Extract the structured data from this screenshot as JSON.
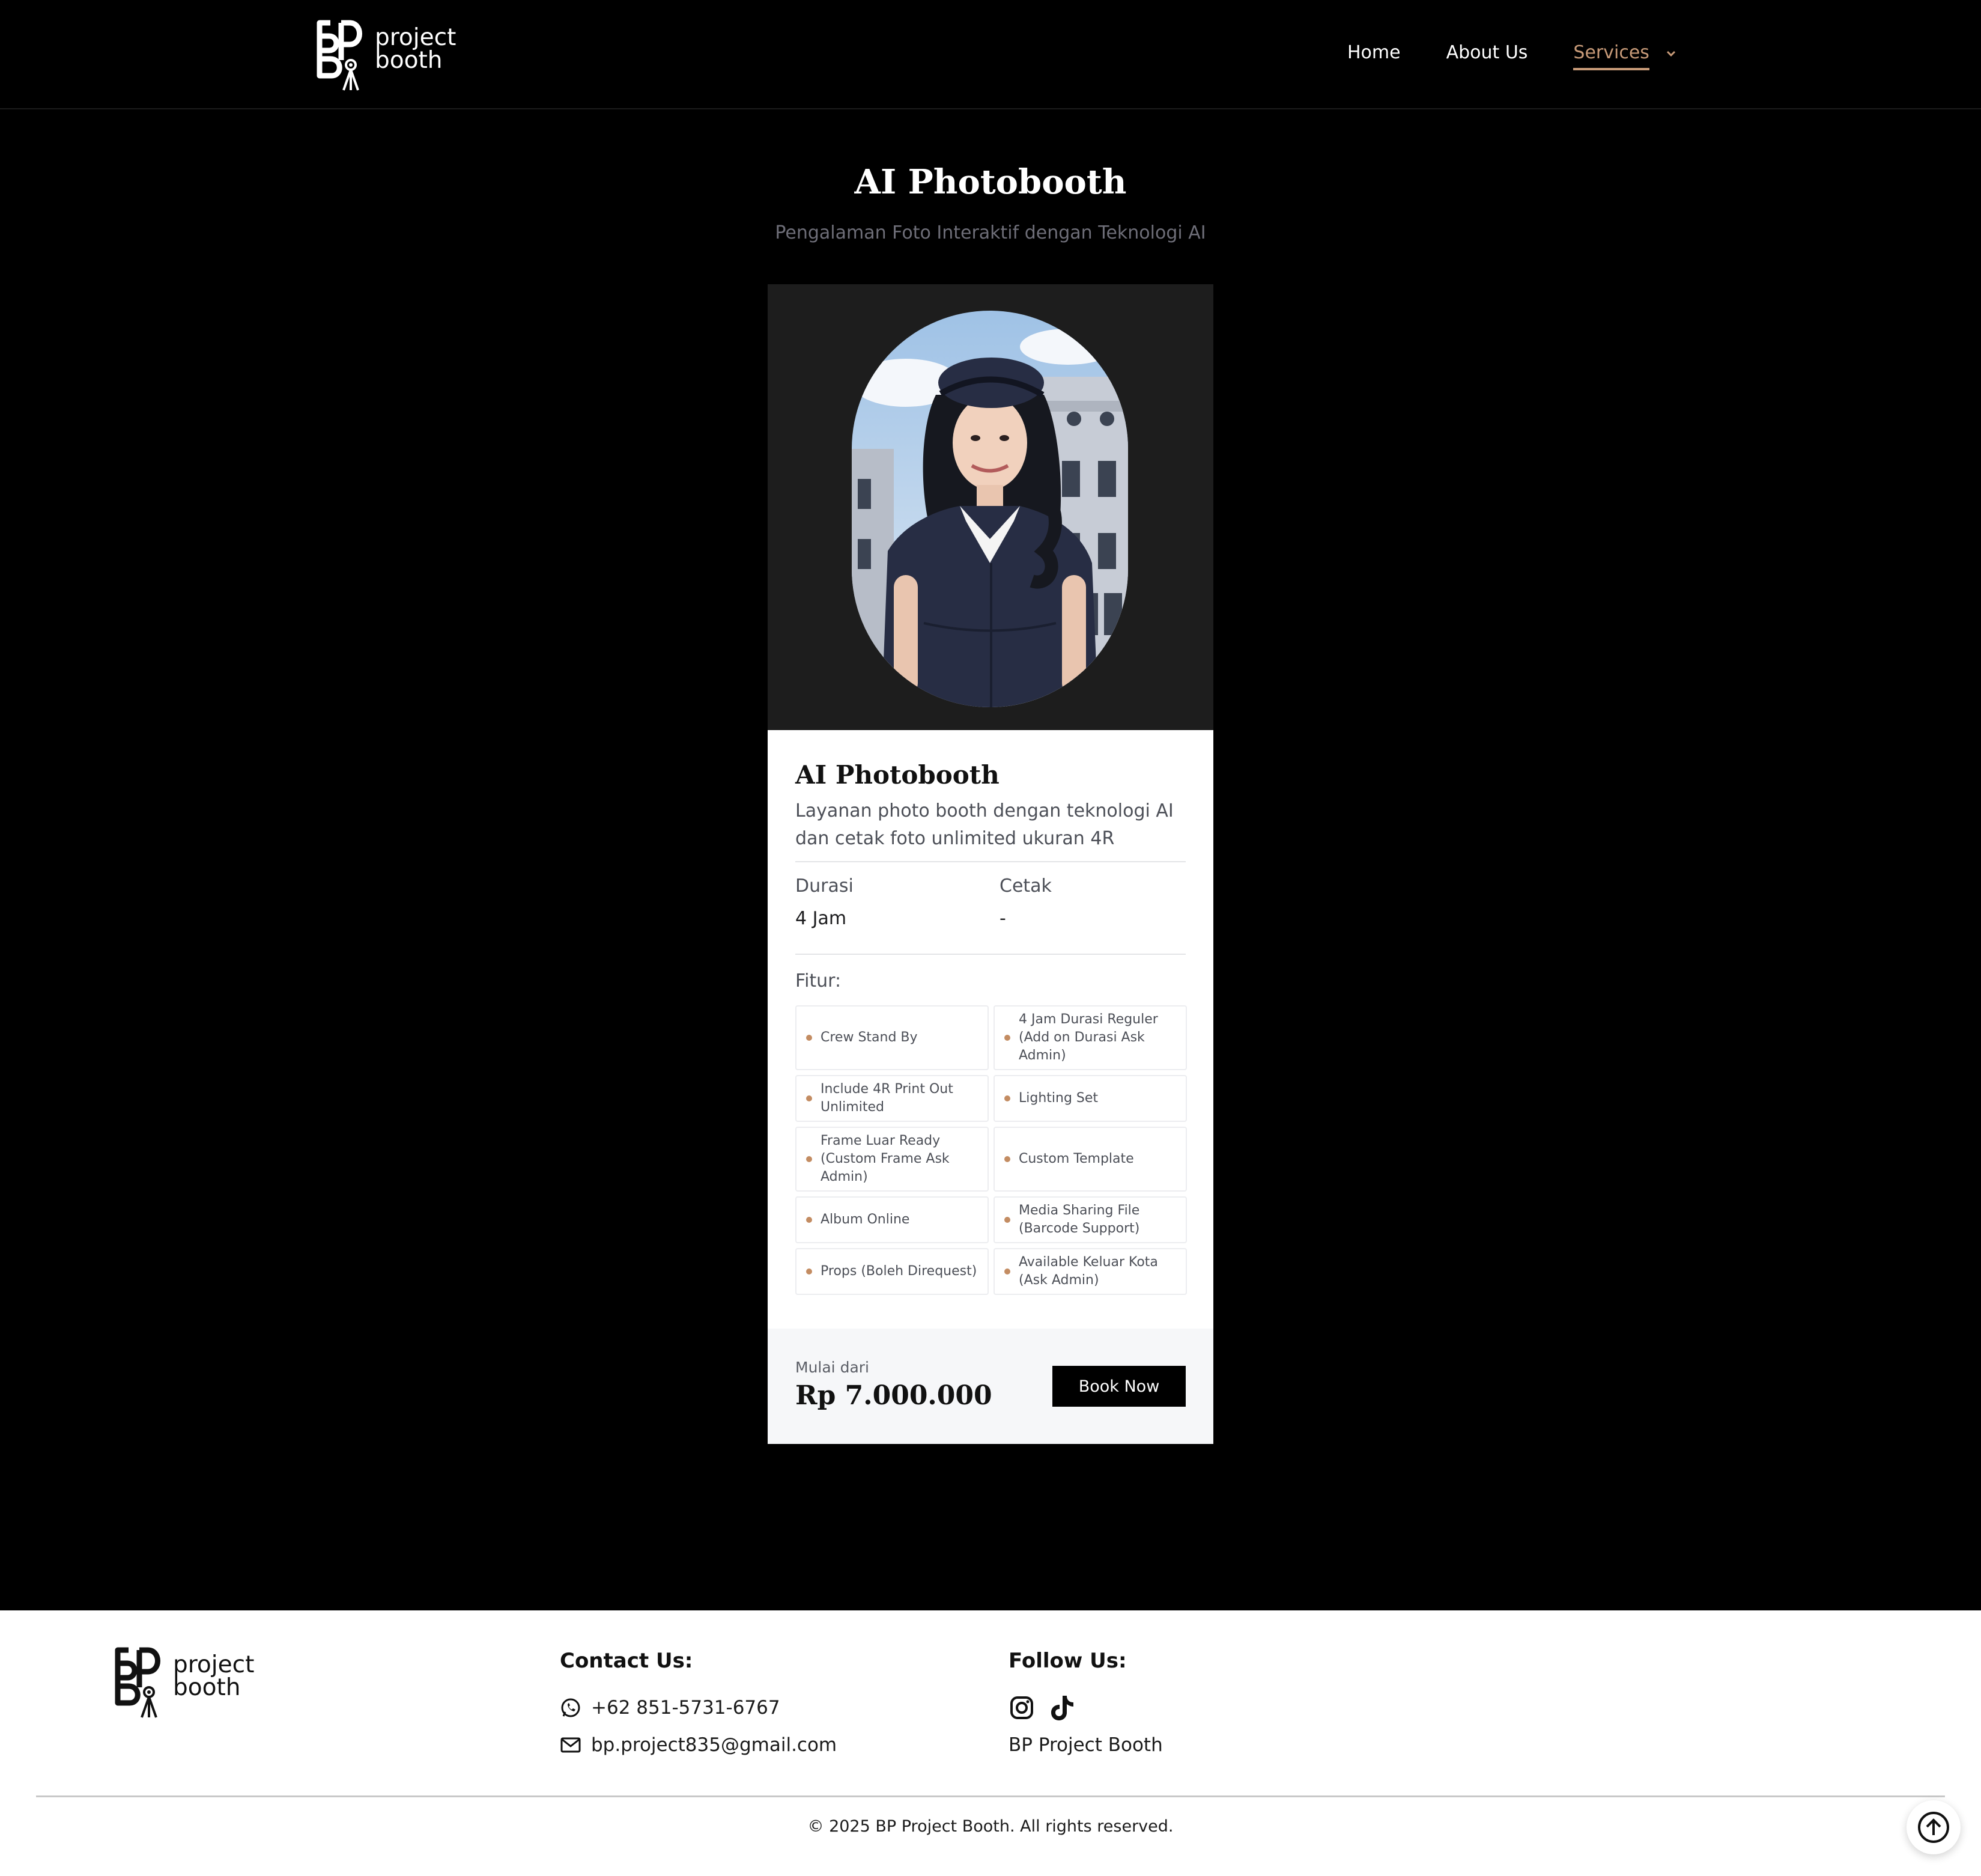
{
  "brand": {
    "word_top": "project",
    "word_bottom": "booth"
  },
  "nav": {
    "home": "Home",
    "about": "About Us",
    "services": "Services"
  },
  "hero": {
    "title": "AI Photobooth",
    "subtitle": "Pengalaman Foto Interaktif dengan Teknologi AI"
  },
  "card": {
    "title": "AI Photobooth",
    "description": "Layanan photo booth dengan teknologi AI dan cetak foto unlimited ukuran 4R",
    "specs": {
      "duration_label": "Durasi",
      "duration_value": "4 Jam",
      "print_label": "Cetak",
      "print_value": "-"
    },
    "features_label": "Fitur:",
    "features": [
      "Crew Stand By",
      "4 Jam Durasi Reguler (Add on Durasi Ask Admin)",
      "Include 4R Print Out Unlimited",
      "Lighting Set",
      "Frame Luar Ready (Custom Frame Ask Admin)",
      "Custom Template",
      "Album Online",
      "Media Sharing File (Barcode Support)",
      "Props (Boleh Direquest)",
      "Available Keluar Kota (Ask Admin)"
    ],
    "price_label": "Mulai dari",
    "price": "Rp 7.000.000",
    "book_label": "Book Now"
  },
  "footer": {
    "contact_heading": "Contact Us:",
    "phone": "+62 851-5731-6767",
    "email": "bp.project835@gmail.com",
    "follow_heading": "Follow Us:",
    "social_name": "BP Project Booth",
    "copyright": "© 2025 BP Project Booth. All rights reserved."
  },
  "colors": {
    "accent": "#c79a78",
    "bullet": "#c38c62",
    "page_bg": "#000000",
    "card_bg": "#ffffff"
  },
  "icons": [
    "bp-logo-icon",
    "chevron-down-icon",
    "whatsapp-icon",
    "mail-icon",
    "instagram-icon",
    "tiktok-icon",
    "arrow-up-icon"
  ]
}
